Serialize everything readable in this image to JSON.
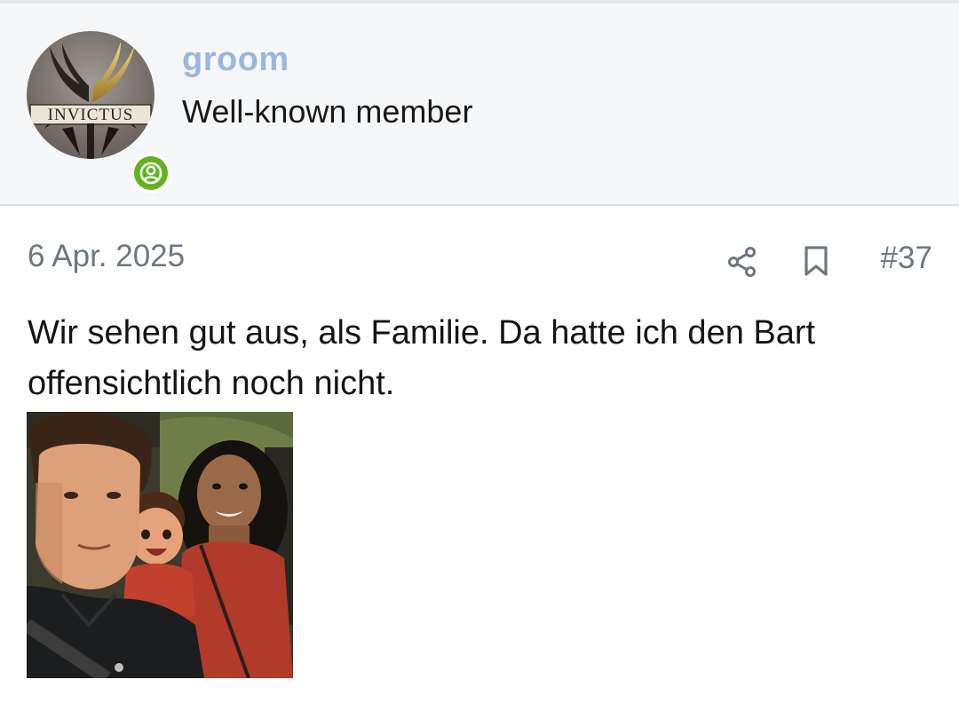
{
  "user": {
    "username": "groom",
    "title": "Well-known member",
    "avatar_text": "INVICTUS",
    "avatar_icon": "winged-invictus-logo",
    "status_icon": "online-user-icon"
  },
  "post": {
    "date": "6 Apr. 2025",
    "number": "#37",
    "text": "Wir sehen gut aus, als Familie. Da hatte ich den Bart offensichtlich noch nicht.",
    "share_icon": "share-icon",
    "bookmark_icon": "bookmark-icon",
    "image_icon": "family-photo"
  },
  "colors": {
    "username": "#9ab8dd",
    "meta": "#6e7781",
    "online": "#63b21f",
    "header_bg": "#f6f7f8"
  }
}
